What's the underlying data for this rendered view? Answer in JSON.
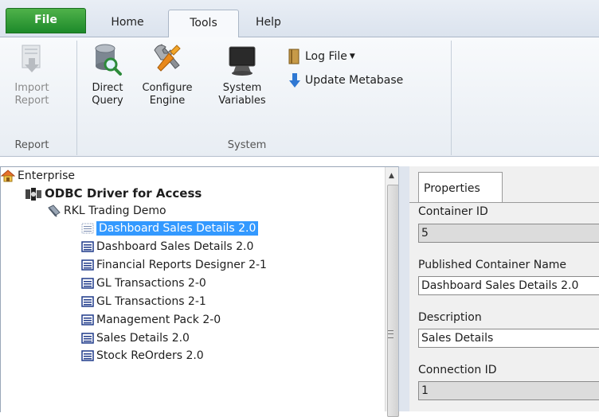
{
  "ribbon": {
    "tabs": {
      "file": "File",
      "home": "Home",
      "tools": "Tools",
      "help": "Help"
    },
    "report_group": {
      "label": "Report",
      "import_report": {
        "line1": "Import",
        "line2": "Report"
      }
    },
    "system_group": {
      "label": "System",
      "direct_query": {
        "line1": "Direct",
        "line2": "Query"
      },
      "configure_engine": {
        "line1": "Configure",
        "line2": "Engine"
      },
      "system_variables": {
        "line1": "System",
        "line2": "Variables"
      },
      "log_file": "Log File",
      "update_metabase": "Update Metabase"
    }
  },
  "tree": {
    "root": "Enterprise",
    "driver": "ODBC Driver for Access",
    "database": "RKL Trading Demo",
    "items": [
      "Dashboard Sales Details 2.0",
      "Dashboard Sales Details 2.0",
      "Financial Reports Designer 2-1",
      "GL Transactions 2-0",
      "GL Transactions 2-1",
      "Management Pack 2-0",
      "Sales Details 2.0",
      "Stock ReOrders 2.0"
    ],
    "selected_index": 0
  },
  "properties": {
    "tab_label": "Properties",
    "container_id_label": "Container ID",
    "container_id_value": "5",
    "published_name_label": "Published Container Name",
    "published_name_value": "Dashboard Sales Details 2.0",
    "description_label": "Description",
    "description_value": "Sales Details",
    "connection_id_label": "Connection ID",
    "connection_id_value": "1"
  },
  "colors": {
    "selection": "#3399ff",
    "file_tab": "#2e9c38"
  }
}
